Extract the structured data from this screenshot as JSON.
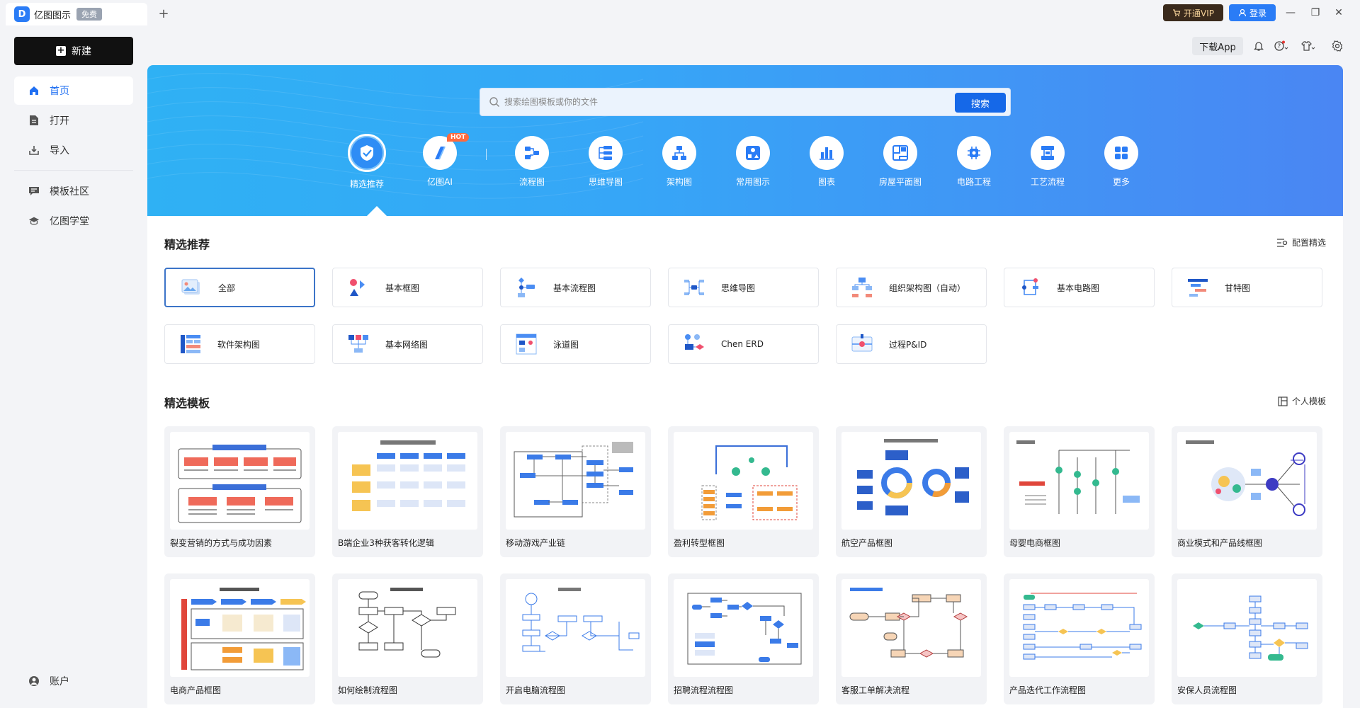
{
  "titlebar": {
    "logo_letter": "D",
    "app_title": "亿图图示",
    "free_badge": "免费",
    "add_tab": "+",
    "vip_label": "开通VIP",
    "login_label": "登录"
  },
  "sidebar": {
    "new_label": "新建",
    "items": [
      {
        "label": "首页",
        "icon": "home-icon",
        "active": true
      },
      {
        "label": "打开",
        "icon": "file-icon",
        "active": false
      },
      {
        "label": "导入",
        "icon": "import-icon",
        "active": false
      },
      {
        "label": "模板社区",
        "icon": "community-icon",
        "active": false
      },
      {
        "label": "亿图学堂",
        "icon": "academy-icon",
        "active": false
      }
    ],
    "account_label": "账户"
  },
  "header": {
    "download_app": "下载App"
  },
  "search": {
    "placeholder": "搜索绘图模板或你的文件",
    "button": "搜索"
  },
  "categories": [
    {
      "label": "精选推荐",
      "icon": "featured-icon",
      "active": true
    },
    {
      "label": "亿图AI",
      "icon": "ai-icon",
      "badge": "HOT"
    },
    {
      "label": "流程图",
      "icon": "flowchart-icon"
    },
    {
      "label": "思维导图",
      "icon": "mindmap-icon"
    },
    {
      "label": "架构图",
      "icon": "architecture-icon"
    },
    {
      "label": "常用图示",
      "icon": "common-diagram-icon"
    },
    {
      "label": "图表",
      "icon": "chart-icon"
    },
    {
      "label": "房屋平面图",
      "icon": "floorplan-icon"
    },
    {
      "label": "电路工程",
      "icon": "circuit-icon"
    },
    {
      "label": "工艺流程",
      "icon": "process-icon"
    },
    {
      "label": "更多",
      "icon": "more-icon"
    }
  ],
  "featured": {
    "title": "精选推荐",
    "action": "配置精选",
    "types": [
      {
        "label": "全部",
        "icon": "all-icon"
      },
      {
        "label": "基本框图",
        "icon": "basic-block-icon"
      },
      {
        "label": "基本流程图",
        "icon": "basic-flowchart-icon"
      },
      {
        "label": "思维导图",
        "icon": "mindmap-type-icon"
      },
      {
        "label": "组织架构图（自动）",
        "icon": "orgchart-icon"
      },
      {
        "label": "基本电路图",
        "icon": "basic-circuit-icon"
      },
      {
        "label": "甘特图",
        "icon": "gantt-icon"
      },
      {
        "label": "软件架构图",
        "icon": "software-arch-icon"
      },
      {
        "label": "基本网络图",
        "icon": "network-icon"
      },
      {
        "label": "泳道图",
        "icon": "swimlane-icon"
      },
      {
        "label": "Chen ERD",
        "icon": "erd-icon"
      },
      {
        "label": "过程P&ID",
        "icon": "pid-icon"
      }
    ]
  },
  "templates": {
    "title": "精选模板",
    "action": "个人模板",
    "items": [
      {
        "label": "裂变营销的方式与成功因素"
      },
      {
        "label": "B端企业3种获客转化逻辑"
      },
      {
        "label": "移动游戏产业链"
      },
      {
        "label": "盈利转型框图"
      },
      {
        "label": "航空产品框图"
      },
      {
        "label": "母婴电商框图"
      },
      {
        "label": "商业模式和产品线框图"
      },
      {
        "label": "电商产品框图"
      },
      {
        "label": "如何绘制流程图"
      },
      {
        "label": "开启电脑流程图"
      },
      {
        "label": "招聘流程流程图"
      },
      {
        "label": "客服工单解决流程"
      },
      {
        "label": "产品迭代工作流程图"
      },
      {
        "label": "安保人员流程图"
      }
    ]
  },
  "colors": {
    "accent": "#2a7cf6",
    "banner_start": "#2fb1f4",
    "banner_end": "#4a86f3",
    "vip_bg": "#3a2a1c"
  }
}
